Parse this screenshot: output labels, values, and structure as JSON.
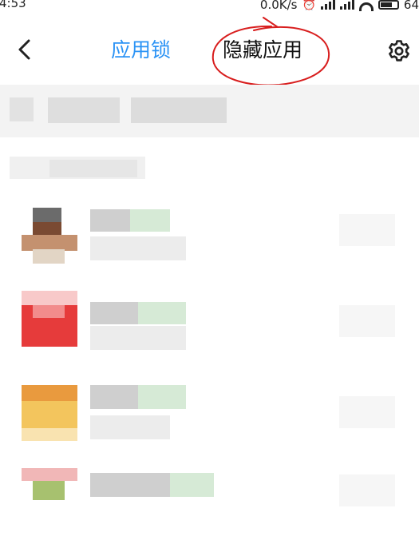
{
  "status_bar": {
    "time": "4:53",
    "network_speed": "0.0K/s",
    "battery_level": "64"
  },
  "header": {
    "tabs": [
      {
        "label": "应用锁",
        "active": true,
        "color": "#2b93f5"
      },
      {
        "label": "隐藏应用",
        "active": false,
        "annotated": true
      }
    ],
    "accent_color": "#2b93f5",
    "annotation_color": "#d81e1e"
  },
  "icons": {
    "back": "chevron-left-icon",
    "settings": "gear-icon"
  },
  "app_rows": [
    {
      "icon_colors": [
        "#7a4a32",
        "#c4916f",
        "#e2d5c5"
      ]
    },
    {
      "icon_colors": [
        "#e63b3b",
        "#f28c8c",
        "#f8c9c9"
      ]
    },
    {
      "icon_colors": [
        "#f3c55d",
        "#e99a3e",
        "#f9e3b0"
      ]
    },
    {
      "icon_colors": [
        "#a7c16f",
        "#f1b7b7",
        "#e2ecd2"
      ]
    }
  ]
}
